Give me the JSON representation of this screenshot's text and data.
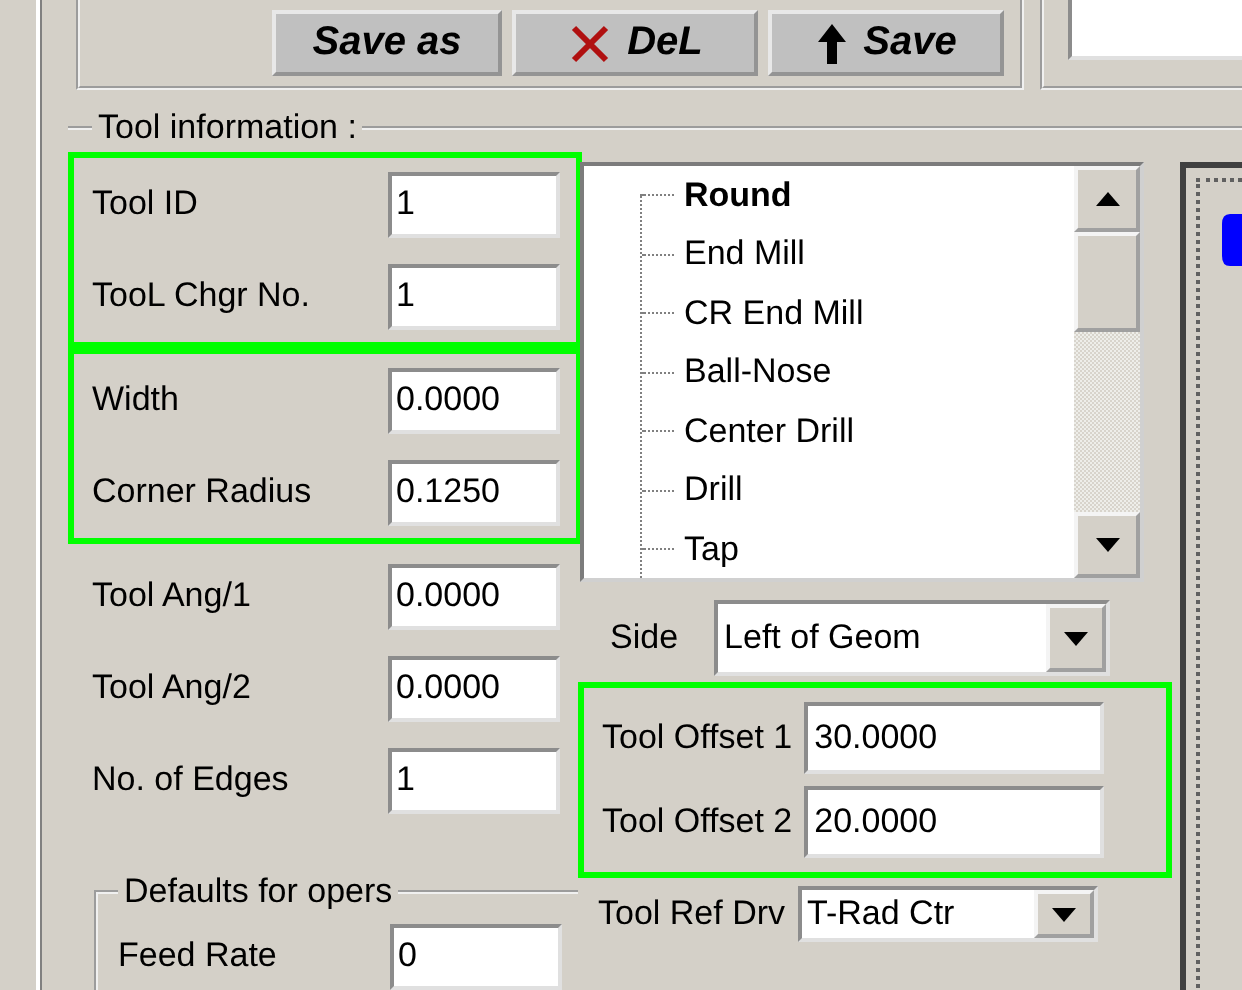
{
  "toolbar": {
    "buttons": [
      {
        "label": "Save as",
        "kind": "plain"
      },
      {
        "label": "DeL",
        "kind": "delete"
      },
      {
        "label": "Save",
        "kind": "upload"
      }
    ]
  },
  "tool_information": {
    "title": "Tool information :",
    "groups": [
      {
        "highlighted": true,
        "fields": [
          {
            "label": "Tool ID",
            "value": "1"
          },
          {
            "label": "TooL Chgr No.",
            "value": "1"
          }
        ]
      },
      {
        "highlighted": true,
        "fields": [
          {
            "label": "Width",
            "value": "0.0000"
          },
          {
            "label": "Corner Radius",
            "value": "0.1250"
          }
        ]
      },
      {
        "highlighted": false,
        "fields": [
          {
            "label": "Tool Ang/1",
            "value": "0.0000"
          },
          {
            "label": "Tool Ang/2",
            "value": "0.0000"
          },
          {
            "label": "No. of Edges",
            "value": "1"
          }
        ]
      }
    ],
    "defaults": {
      "title": "Defaults for opers",
      "fields": [
        {
          "label": "Feed Rate",
          "value": "0"
        }
      ]
    },
    "tool_types": [
      {
        "label": "Round",
        "selected": true
      },
      {
        "label": "End Mill",
        "selected": false
      },
      {
        "label": "CR End Mill",
        "selected": false
      },
      {
        "label": "Ball-Nose",
        "selected": false
      },
      {
        "label": "Center Drill",
        "selected": false
      },
      {
        "label": "Drill",
        "selected": false
      },
      {
        "label": "Tap",
        "selected": false
      }
    ],
    "side": {
      "label": "Side",
      "value": "Left of Geom"
    },
    "offsets": {
      "highlighted": true,
      "fields": [
        {
          "label": "Tool Offset 1",
          "value": "30.0000"
        },
        {
          "label": "Tool Offset 2",
          "value": "20.0000"
        }
      ]
    },
    "reference": {
      "label": "Tool Ref Drv",
      "value": "T-Rad Ctr"
    }
  }
}
